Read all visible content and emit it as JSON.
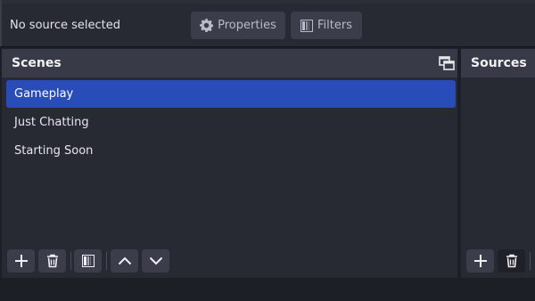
{
  "source_toolbar": {
    "status": "No source selected",
    "properties_label": "Properties",
    "filters_label": "Filters"
  },
  "scenes_dock": {
    "title": "Scenes",
    "items": [
      {
        "label": "Gameplay",
        "selected": true
      },
      {
        "label": "Just Chatting",
        "selected": false
      },
      {
        "label": "Starting Soon",
        "selected": false
      }
    ],
    "toolbar_icons": [
      "plus-icon",
      "trash-icon",
      "filter-icon",
      "chevron-up-icon",
      "chevron-down-icon"
    ],
    "undock_icon": "undock-icon"
  },
  "sources_dock": {
    "title": "Sources",
    "toolbar_icons": [
      "plus-icon",
      "trash-icon"
    ]
  },
  "colors": {
    "selection": "#284cb8",
    "dock_title": "#383b47",
    "dock_bg": "#272a33",
    "button_bg": "#3b3e4a"
  }
}
